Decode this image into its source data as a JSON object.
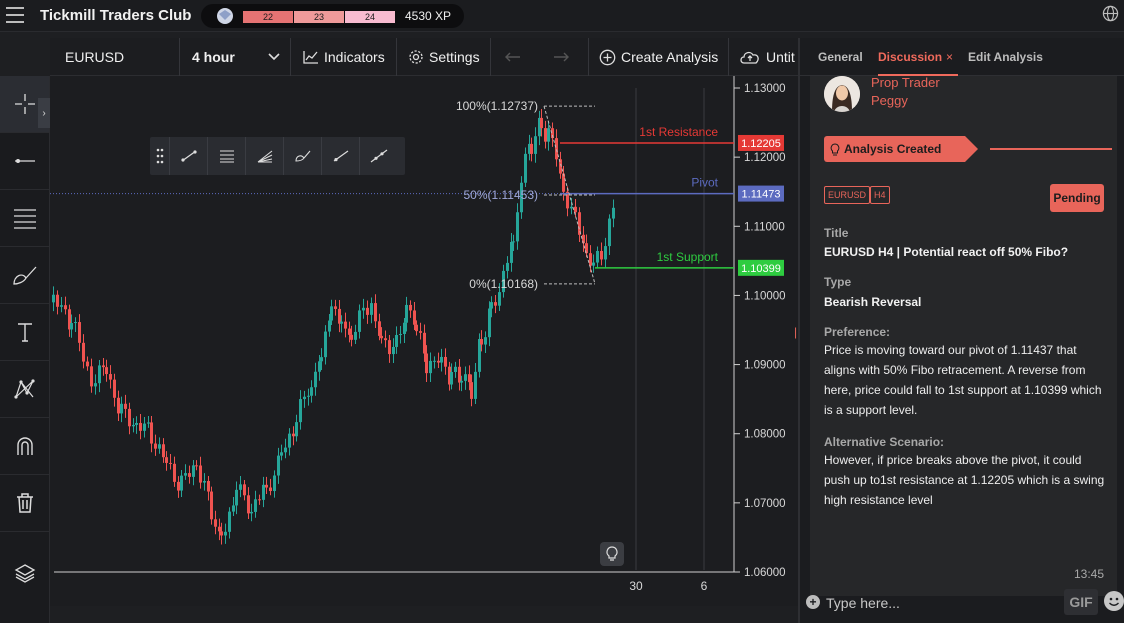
{
  "app": {
    "title": "Tickmill Traders Club"
  },
  "xp": {
    "levels": [
      "22",
      "23",
      "24"
    ],
    "value": "4530 XP",
    "progress": 0.55
  },
  "toolbar": {
    "symbol": "EURUSD",
    "timeframe": "4 hour",
    "indicators": "Indicators",
    "settings": "Settings",
    "create_analysis": "Create Analysis",
    "untitled": "Untit"
  },
  "chart": {
    "y_ticks": [
      "1.13000",
      "1.12000",
      "1.11000",
      "1.10000",
      "1.09000",
      "1.08000",
      "1.07000",
      "1.06000"
    ],
    "x_ticks": [
      "30",
      "6"
    ],
    "levels": [
      {
        "label": "1st Resistance",
        "value": "1.12205",
        "color": "#e53935"
      },
      {
        "label": "Pivot",
        "value": "1.11473",
        "color": "#5c6bc0"
      },
      {
        "label": "1st Support",
        "value": "1.10399",
        "color": "#2ecc40"
      }
    ],
    "fib": [
      {
        "label": "100%(1.12737)"
      },
      {
        "label": "50%(1.11453)"
      },
      {
        "label": "0%(1.10168)"
      }
    ]
  },
  "panel": {
    "tabs": [
      {
        "label": "General"
      },
      {
        "label": "Discussion"
      },
      {
        "label": "Edit Analysis"
      }
    ],
    "close": "×",
    "author_role": "Prop Trader",
    "author_name": "Peggy",
    "created_label": "Analysis Created",
    "tags": [
      "EURUSD",
      "H4"
    ],
    "status": "Pending",
    "title_label": "Title",
    "title_value": "EURUSD H4 | Potential react off 50% Fibo?",
    "type_label": "Type",
    "type_value": "Bearish Reversal",
    "preference_label": "Preference:",
    "preference_text": "Price is moving toward our pivot of 1.11437 that aligns with 50% Fibo retracement. A reverse from here, price could fall to 1st support at 1.10399 which is a support level.",
    "alt_label": "Alternative Scenario:",
    "alt_text": "However, if price breaks above the pivot, it could push up to1st resistance at 1.12205 which is a swing high resistance level",
    "time": "13:45",
    "composer_placeholder": "Type here...",
    "gif_label": "GIF"
  }
}
